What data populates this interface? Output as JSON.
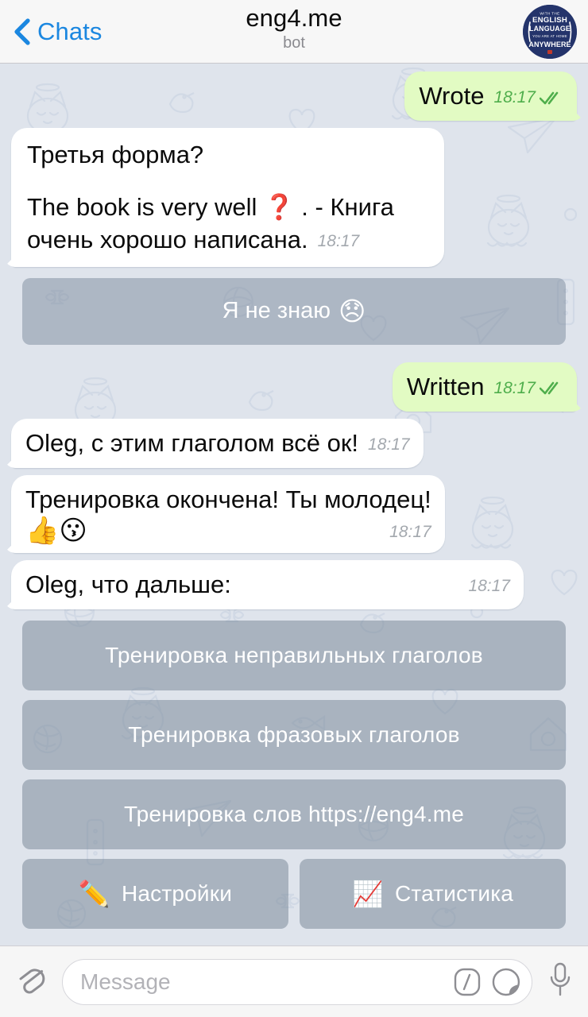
{
  "header": {
    "back_label": "Chats",
    "back_icon": "chevron-left-icon",
    "title": "eng4.me",
    "subtitle": "bot",
    "avatar_text_lines": [
      "WITH THE",
      "ENGLISH",
      "LANGUAGE",
      "YOU ARE AT HOME",
      "ANYWHERE"
    ],
    "avatar_bg": "#24346b"
  },
  "colors": {
    "chat_background": "#dfe4ec",
    "incoming_bubble": "#ffffff",
    "outgoing_bubble": "#e2fbc3",
    "outgoing_meta": "#4fae4c",
    "incoming_meta": "#a3a8ae",
    "accent_blue": "#1b87e0",
    "keyboard_button": "rgba(124,138,155,.55)"
  },
  "messages": [
    {
      "id": "msg-wrote",
      "direction": "out",
      "text": "Wrote",
      "time": "18:17",
      "status": "read",
      "status_icon": "double-check-icon"
    },
    {
      "id": "msg-third-form",
      "direction": "in",
      "paragraphs": [
        "Третья форма?",
        "The book is very well ❓ . - Книга очень хорошо написана."
      ],
      "line1": "Третья форма?",
      "line2_a": "The book is very well ",
      "line2_emoji": "❓",
      "line2_b": " . - Книга очень хорошо написана.",
      "time": "18:17"
    },
    {
      "id": "msg-written",
      "direction": "out",
      "text": "Written",
      "time": "18:17",
      "status": "read",
      "status_icon": "double-check-icon"
    },
    {
      "id": "msg-verb-ok",
      "direction": "in",
      "text": "Oleg, с этим глаголом всё ок!",
      "time": "18:17"
    },
    {
      "id": "msg-training-done",
      "direction": "in",
      "text": "Тренировка окончена! Ты молодец!",
      "emoji": "👍😗",
      "emoji_names": [
        "thumbs-up-emoji",
        "kissing-face-emoji"
      ],
      "time": "18:17"
    },
    {
      "id": "msg-what-next",
      "direction": "in",
      "text": "Oleg, что дальше:",
      "time": "18:17"
    }
  ],
  "inline_button_dont_know": {
    "label": "Я не знаю ",
    "emoji": "😞",
    "emoji_name": "disappointed-face-emoji"
  },
  "keyboard": {
    "rows": [
      [
        {
          "label": "Тренировка неправильных глаголов",
          "name": "kb-irregular-verbs"
        }
      ],
      [
        {
          "label": "Тренировка фразовых глаголов",
          "name": "kb-phrasal-verbs"
        }
      ],
      [
        {
          "label": "Тренировка слов https://eng4.me",
          "name": "kb-word-training"
        }
      ],
      [
        {
          "label": "Настройки",
          "emoji": "✏️",
          "emoji_name": "pencil-emoji",
          "name": "kb-settings"
        },
        {
          "label": "Статистика",
          "emoji": "📈",
          "emoji_name": "chart-increasing-emoji",
          "name": "kb-statistics"
        }
      ]
    ]
  },
  "composer": {
    "attach_icon": "paperclip-icon",
    "placeholder": "Message",
    "value": "",
    "command_icon": "slash-command-icon",
    "command_glyph": "/",
    "sticker_icon": "sticker-icon",
    "mic_icon": "microphone-icon"
  }
}
